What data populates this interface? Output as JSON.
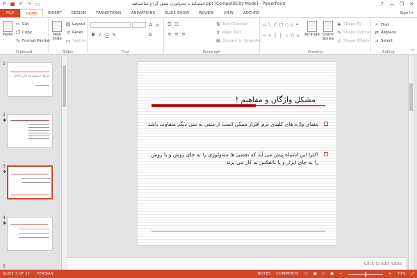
{
  "window": {
    "title": "استنباط با متدولوژی شش گرا و ساختیافته.ppt [Compatibility Mode] - PowerPoint",
    "help": "?",
    "minimize": "—",
    "restore": "❐",
    "close": "✕"
  },
  "tabs": [
    "FILE",
    "HOME",
    "INSERT",
    "DESIGN",
    "TRANSITIONS",
    "ANIMATIONS",
    "SLIDE SHOW",
    "REVIEW",
    "VIEW",
    "ADD-INS"
  ],
  "active_tab": "HOME",
  "signin": "Sign in",
  "ribbon": {
    "clipboard": {
      "label": "Clipboard",
      "paste": "Paste",
      "cut": "Cut",
      "copy": "Copy",
      "format_painter": "Format Painter"
    },
    "slides": {
      "label": "Slides",
      "new_slide": "New Slide",
      "layout": "Layout",
      "reset": "Reset",
      "section": "Section"
    },
    "font": {
      "label": "Font"
    },
    "paragraph": {
      "label": "Paragraph",
      "text_direction": "Text Direction",
      "align_text": "Align Text",
      "convert": "Convert to SmartArt"
    },
    "drawing": {
      "label": "Drawing",
      "arrange": "Arrange",
      "quick_styles": "Quick Styles",
      "shape_fill": "Shape Fill",
      "shape_outline": "Shape Outline",
      "shape_effects": "Shape Effects"
    },
    "editing": {
      "label": "Editing",
      "find": "Find",
      "replace": "Replace",
      "select": "Select"
    }
  },
  "thumbnails": [
    {
      "num": "1",
      "title": "استنباط با متدولوژی شی گرا و ساختیافته"
    },
    {
      "num": "2",
      "title": ""
    },
    {
      "num": "3",
      "title": ""
    },
    {
      "num": "4",
      "title": ""
    },
    {
      "num": "5",
      "title": ""
    }
  ],
  "slide": {
    "title": "مشکل واژگان و مفاهیم !",
    "bullets": [
      "معنای واژه های کلیدی نرم افزار ممکن است از متنی به متن دیگر متفاوت باشد",
      "اکثرا این اشتباه پیش می آید که بعضی ها متدولوژی را به جای روش و یا روش را به جای ابزار و یا بالعکس به کار می برند"
    ]
  },
  "notes_placeholder": "Click to add notes",
  "status": {
    "slide": "SLIDE 3 OF 27",
    "language": "PERSIAN",
    "notes": "NOTES",
    "comments": "COMMENTS",
    "zoom": "70%"
  },
  "colors": {
    "accent": "#d24726",
    "title_rule": "#c0504d"
  }
}
